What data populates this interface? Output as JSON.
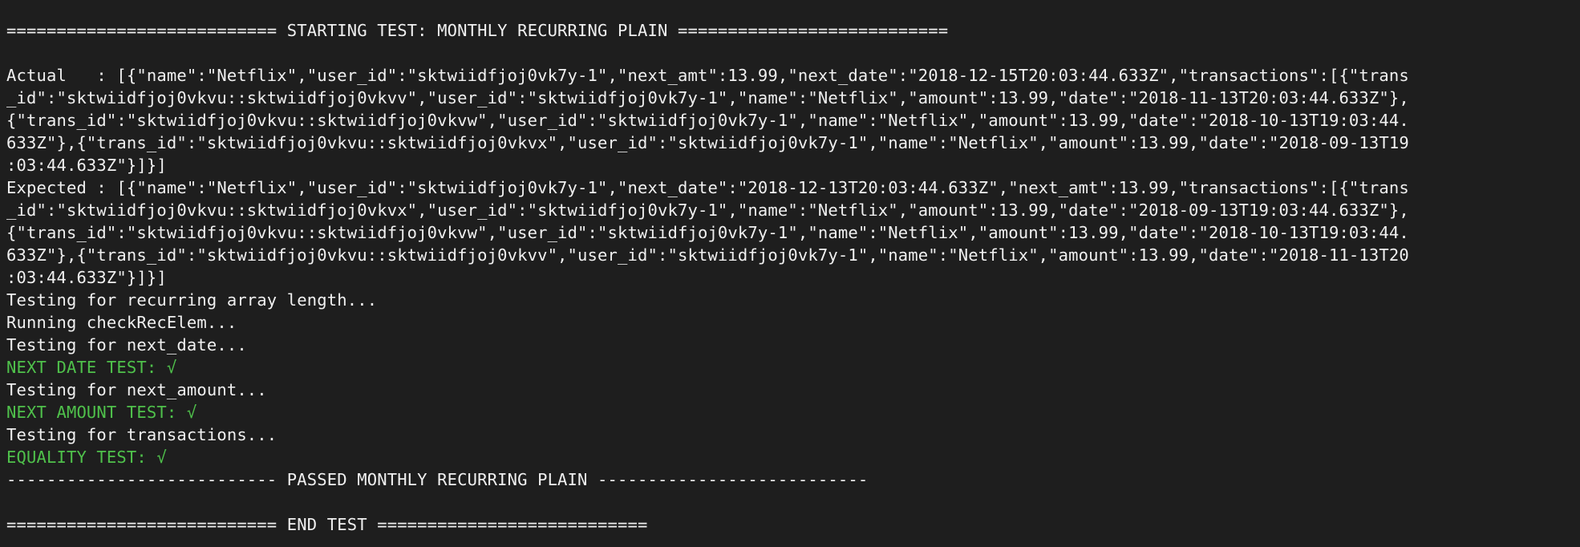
{
  "terminal": {
    "header_start": "=========================== STARTING TEST: MONTHLY RECURRING PLAIN ===========================",
    "actual": [
      "Actual   : [{\"name\":\"Netflix\",\"user_id\":\"sktwiidfjoj0vk7y-1\",\"next_amt\":13.99,\"next_date\":\"2018-12-15T20:03:44.633Z\",\"transactions\":[{\"trans",
      "_id\":\"sktwiidfjoj0vkvu::sktwiidfjoj0vkvv\",\"user_id\":\"sktwiidfjoj0vk7y-1\",\"name\":\"Netflix\",\"amount\":13.99,\"date\":\"2018-11-13T20:03:44.633Z\"},",
      "{\"trans_id\":\"sktwiidfjoj0vkvu::sktwiidfjoj0vkvw\",\"user_id\":\"sktwiidfjoj0vk7y-1\",\"name\":\"Netflix\",\"amount\":13.99,\"date\":\"2018-10-13T19:03:44.",
      "633Z\"},{\"trans_id\":\"sktwiidfjoj0vkvu::sktwiidfjoj0vkvx\",\"user_id\":\"sktwiidfjoj0vk7y-1\",\"name\":\"Netflix\",\"amount\":13.99,\"date\":\"2018-09-13T19",
      ":03:44.633Z\"}]}]"
    ],
    "expected": [
      "Expected : [{\"name\":\"Netflix\",\"user_id\":\"sktwiidfjoj0vk7y-1\",\"next_date\":\"2018-12-13T20:03:44.633Z\",\"next_amt\":13.99,\"transactions\":[{\"trans",
      "_id\":\"sktwiidfjoj0vkvu::sktwiidfjoj0vkvx\",\"user_id\":\"sktwiidfjoj0vk7y-1\",\"name\":\"Netflix\",\"amount\":13.99,\"date\":\"2018-09-13T19:03:44.633Z\"},",
      "{\"trans_id\":\"sktwiidfjoj0vkvu::sktwiidfjoj0vkvw\",\"user_id\":\"sktwiidfjoj0vk7y-1\",\"name\":\"Netflix\",\"amount\":13.99,\"date\":\"2018-10-13T19:03:44.",
      "633Z\"},{\"trans_id\":\"sktwiidfjoj0vkvu::sktwiidfjoj0vkvv\",\"user_id\":\"sktwiidfjoj0vk7y-1\",\"name\":\"Netflix\",\"amount\":13.99,\"date\":\"2018-11-13T20",
      ":03:44.633Z\"}]}]"
    ],
    "testing_array_length": "Testing for recurring array length...",
    "running_check": "Running checkRecElem...",
    "testing_next_date": "Testing for next_date...",
    "next_date_result": "NEXT DATE TEST: √",
    "testing_next_amount": "Testing for next_amount...",
    "next_amount_result": "NEXT AMOUNT TEST: √",
    "testing_transactions": "Testing for transactions...",
    "equality_result": "EQUALITY TEST: √",
    "passed_footer": "--------------------------- PASSED MONTHLY RECURRING PLAIN ---------------------------",
    "end_footer": "=========================== END TEST ==========================="
  },
  "colors": {
    "background": "#1e1e1e",
    "text": "#f0f0f0",
    "success": "#4fc14b"
  }
}
